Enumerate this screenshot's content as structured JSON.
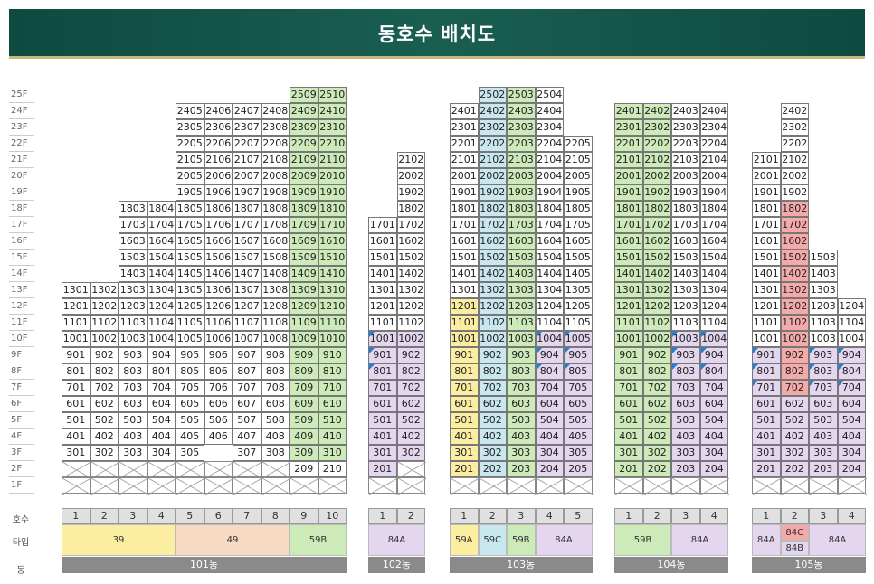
{
  "title": "동호수 배치도",
  "row_labels": {
    "hosu": "호수",
    "type": "타입",
    "dong": "동"
  },
  "floors": [
    "25F",
    "24F",
    "23F",
    "22F",
    "21F",
    "20F",
    "19F",
    "18F",
    "17F",
    "16F",
    "15F",
    "14F",
    "13F",
    "12F",
    "11F",
    "10F",
    "9F",
    "8F",
    "7F",
    "6F",
    "5F",
    "4F",
    "3F",
    "2F",
    "1F"
  ],
  "colors": {
    "yellow": "#fbeea0",
    "peach": "#f8d9c4",
    "green": "#cdeab9",
    "blue": "#c9e7ee",
    "purple": "#e4d6ee",
    "red": "#f4aaa8",
    "orange": "#f8d9c4"
  },
  "buildings": [
    {
      "name": "101동",
      "lines": [
        1,
        2,
        3,
        4,
        5,
        6,
        7,
        8,
        9,
        10
      ],
      "ranges": [
        [
          3,
          13
        ],
        [
          3,
          13
        ],
        [
          3,
          18
        ],
        [
          3,
          18
        ],
        [
          3,
          24
        ],
        [
          4,
          24
        ],
        [
          3,
          24
        ],
        [
          3,
          24
        ],
        [
          2,
          25
        ],
        [
          2,
          25
        ]
      ],
      "colorRules": [
        {
          "lines": [
            9,
            10
          ],
          "from": 2,
          "to": 25,
          "color": "green",
          "except": [
            [
              9,
              2
            ],
            [
              10,
              2
            ]
          ]
        }
      ],
      "twoNoUnits": [
        [
          5,
          2
        ],
        [
          6,
          2
        ]
      ],
      "types": [
        {
          "label": "39",
          "span": 4,
          "color": "yellow"
        },
        {
          "label": "49",
          "span": 4,
          "color": "peach"
        },
        {
          "label": "59B",
          "span": 2,
          "color": "green"
        }
      ]
    },
    {
      "name": "102동",
      "lines": [
        1,
        2
      ],
      "ranges": [
        [
          2,
          17
        ],
        [
          3,
          21
        ]
      ],
      "colorRules": [
        {
          "lines": [
            1,
            2
          ],
          "from": 3,
          "to": 10,
          "color": "purple"
        },
        {
          "lines": [
            1
          ],
          "from": 2,
          "to": 2,
          "color": "purple"
        }
      ],
      "triangles": [
        [
          1,
          10
        ],
        [
          1,
          9
        ],
        [
          1,
          8
        ]
      ],
      "types": [
        {
          "label": "84A",
          "span": 2,
          "color": "purple"
        }
      ]
    },
    {
      "name": "103동",
      "lines": [
        1,
        2,
        3,
        4,
        5
      ],
      "ranges": [
        [
          2,
          24
        ],
        [
          2,
          25
        ],
        [
          2,
          25
        ],
        [
          2,
          25
        ],
        [
          2,
          22
        ]
      ],
      "colorRules": [
        {
          "lines": [
            1
          ],
          "from": 2,
          "to": 12,
          "color": "yellow"
        },
        {
          "lines": [
            2
          ],
          "from": 2,
          "to": 25,
          "color": "blue"
        },
        {
          "lines": [
            3
          ],
          "from": 2,
          "to": 25,
          "color": "green"
        },
        {
          "lines": [
            4,
            5
          ],
          "from": 2,
          "to": 10,
          "color": "purple"
        }
      ],
      "triangles": [
        [
          4,
          10
        ],
        [
          5,
          10
        ],
        [
          4,
          9
        ],
        [
          5,
          9
        ],
        [
          4,
          8
        ],
        [
          5,
          8
        ]
      ],
      "types": [
        {
          "label": "59A",
          "span": 1,
          "color": "yellow"
        },
        {
          "label": "59C",
          "span": 1,
          "color": "blue"
        },
        {
          "label": "59B",
          "span": 1,
          "color": "green"
        },
        {
          "label": "84A",
          "span": 2,
          "color": "purple"
        }
      ]
    },
    {
      "name": "104동",
      "lines": [
        1,
        2,
        3,
        4
      ],
      "ranges": [
        [
          2,
          24
        ],
        [
          2,
          24
        ],
        [
          2,
          24
        ],
        [
          2,
          24
        ]
      ],
      "colorRules": [
        {
          "lines": [
            1,
            2
          ],
          "from": 2,
          "to": 24,
          "color": "green"
        },
        {
          "lines": [
            3,
            4
          ],
          "from": 2,
          "to": 10,
          "color": "purple"
        }
      ],
      "triangles": [
        [
          3,
          10
        ],
        [
          4,
          10
        ],
        [
          3,
          9
        ],
        [
          4,
          9
        ],
        [
          3,
          8
        ],
        [
          4,
          8
        ]
      ],
      "types": [
        {
          "label": "59B",
          "span": 2,
          "color": "green"
        },
        {
          "label": "84A",
          "span": 2,
          "color": "purple"
        }
      ]
    },
    {
      "name": "105동",
      "lines": [
        1,
        2,
        3,
        4
      ],
      "ranges": [
        [
          2,
          21
        ],
        [
          2,
          24
        ],
        [
          2,
          15
        ],
        [
          2,
          12
        ]
      ],
      "colorRules": [
        {
          "lines": [
            1
          ],
          "from": 2,
          "to": 9,
          "color": "purple"
        },
        {
          "lines": [
            2
          ],
          "from": 2,
          "to": 6,
          "color": "purple"
        },
        {
          "lines": [
            2
          ],
          "from": 7,
          "to": 18,
          "color": "red"
        },
        {
          "lines": [
            3,
            4
          ],
          "from": 2,
          "to": 9,
          "color": "purple"
        }
      ],
      "triangles": [
        [
          1,
          9
        ],
        [
          3,
          9
        ],
        [
          4,
          9
        ],
        [
          1,
          8
        ],
        [
          3,
          8
        ],
        [
          4,
          8
        ],
        [
          1,
          7
        ],
        [
          3,
          7
        ],
        [
          4,
          7
        ]
      ],
      "types": [
        {
          "label": "84A",
          "span": 1,
          "color": "purple"
        },
        {
          "label": "84C",
          "span": 1,
          "color": "red",
          "second": "84B",
          "secondColor": "purple"
        },
        {
          "label": "84A",
          "span": 2,
          "color": "purple"
        }
      ]
    }
  ]
}
